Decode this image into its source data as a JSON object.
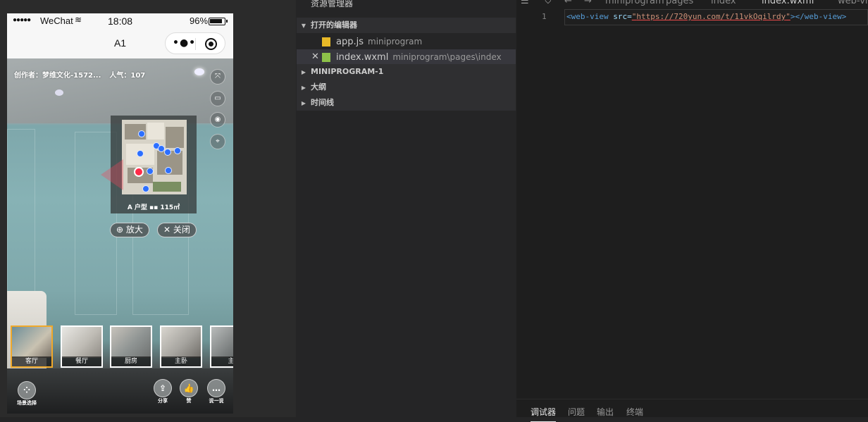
{
  "phone": {
    "status": {
      "signal": "●●●●●",
      "carrier": "WeChat",
      "wifi_icon": "wifi-icon",
      "time": "18:08",
      "battery": "96%"
    },
    "nav": {
      "title": "A1"
    },
    "scene": {
      "author": "创作者：梦维文化-1572...",
      "popularity": "人气：107",
      "floorplan_legend": "A 户型  ▪▪ 115㎡",
      "zoom_label": "放大",
      "close_label": "关闭",
      "thumbs": [
        "客厅",
        "餐厅",
        "厨房",
        "主卧",
        "主"
      ],
      "bottom": {
        "scene_select": "场景选择",
        "share": "分享",
        "like": "赞",
        "comment": "说一说"
      }
    }
  },
  "explorer": {
    "title": "资源管理器",
    "sections": {
      "open_editors": "打开的编辑器",
      "project": "MINIPROGRAM-1",
      "outline": "大纲",
      "timeline": "时间线"
    },
    "files": [
      {
        "name": "app.js",
        "path": "miniprogram"
      },
      {
        "name": "index.wxml",
        "path": "miniprogram\\pages\\index"
      }
    ]
  },
  "editor": {
    "breadcrumbs": [
      "miniprogram",
      "pages",
      "index",
      "index.wxml",
      "web-vi"
    ],
    "line_number": "1",
    "code": {
      "open_tag": "<web-view",
      "attr": " src=",
      "quote_open": "\"",
      "url": "https://720yun.com/t/11vkOqilrdy",
      "quote_close": "\"",
      "close": "></web-view>"
    },
    "panel_tabs": [
      "调试器",
      "问题",
      "输出",
      "终端"
    ]
  },
  "colors": {
    "accent_thumb": "#f0a92b",
    "current_dot": "#ff2b48",
    "dot": "#2c6fff",
    "tag": "#569cd6"
  }
}
